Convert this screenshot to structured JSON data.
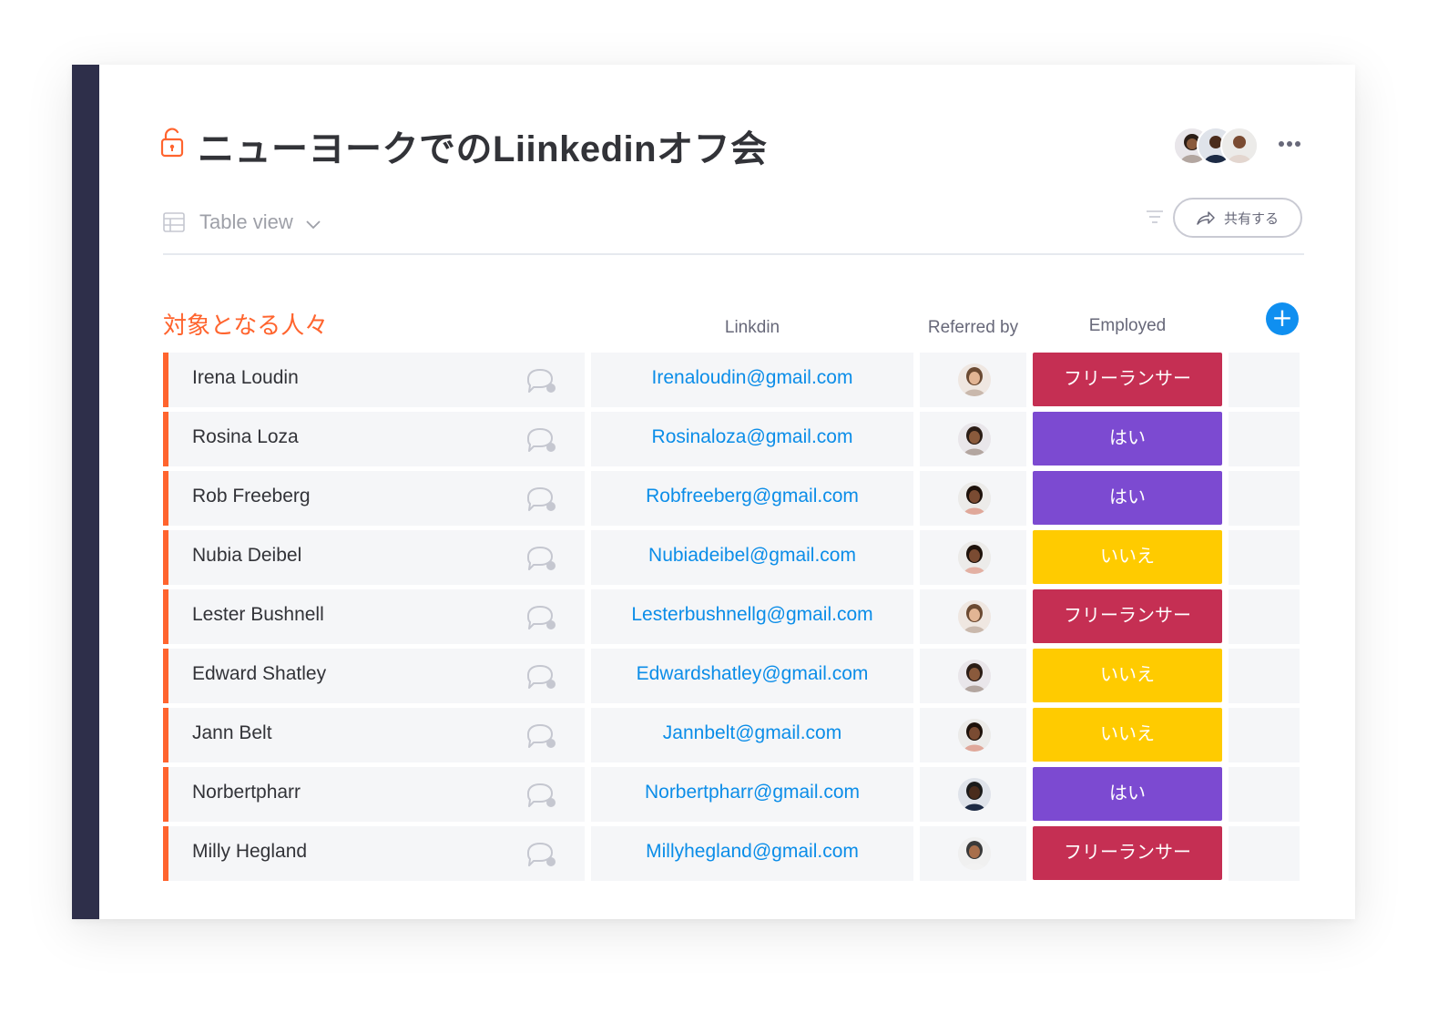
{
  "board": {
    "title": "ニューヨークでのLiinkedinオフ会",
    "view_label": "Table view",
    "share_label": "共有する"
  },
  "colors": {
    "accent_orange": "#ff642e",
    "link_blue": "#0b8de8",
    "status_freelancer": "#c52f53",
    "status_yes": "#7c4ad1",
    "status_no": "#ffcb00",
    "add_button": "#0f8ff0",
    "left_bar": "#2e2f4a"
  },
  "group": {
    "title": "対象となる人々"
  },
  "columns": {
    "linkdin": "Linkdin",
    "referred_by": "Referred by",
    "employed": "Employed"
  },
  "rows": [
    {
      "name": "Irena Loudin",
      "email": "Irenaloudin@gmail.com",
      "status": "フリーランサー",
      "status_color": "#c52f53"
    },
    {
      "name": "Rosina Loza",
      "email": "Rosinaloza@gmail.com",
      "status": "はい",
      "status_color": "#7c4ad1"
    },
    {
      "name": "Rob Freeberg",
      "email": "Robfreeberg@gmail.com",
      "status": "はい",
      "status_color": "#7c4ad1"
    },
    {
      "name": "Nubia Deibel",
      "email": "Nubiadeibel@gmail.com",
      "status": "いいえ",
      "status_color": "#ffcb00"
    },
    {
      "name": "Lester Bushnell",
      "email": "Lesterbushnellg@gmail.com",
      "status": "フリーランサー",
      "status_color": "#c52f53"
    },
    {
      "name": "Edward Shatley",
      "email": "Edwardshatley@gmail.com",
      "status": "いいえ",
      "status_color": "#ffcb00"
    },
    {
      "name": "Jann Belt",
      "email": "Jannbelt@gmail.com",
      "status": "いいえ",
      "status_color": "#ffcb00"
    },
    {
      "name": "Norbertpharr",
      "email": "Norbertpharr@gmail.com",
      "status": "はい",
      "status_color": "#7c4ad1"
    },
    {
      "name": "Milly Hegland",
      "email": "Millyhegland@gmail.com",
      "status": "フリーランサー",
      "status_color": "#c52f53"
    }
  ]
}
